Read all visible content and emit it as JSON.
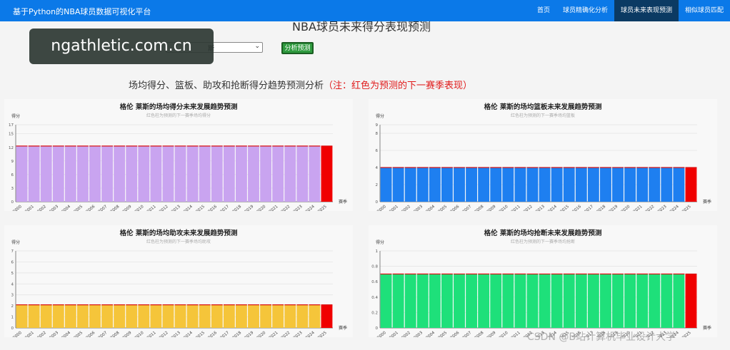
{
  "navbar": {
    "brand": "基于Python的NBA球员数据可视化平台",
    "links": [
      {
        "label": "首页",
        "active": false
      },
      {
        "label": "球员精确化分析",
        "active": false
      },
      {
        "label": "球员未来表现预测",
        "active": true
      },
      {
        "label": "相似球员匹配",
        "active": false
      }
    ]
  },
  "page_title": "NBA球员未来得分表现预测",
  "player_select": {
    "value": "斯"
  },
  "predict_button": "分析预测",
  "section_title": "场均得分、篮板、助攻和抢断得分趋势预测分析",
  "section_note": "（注：红色为预测的下一赛季表现）",
  "watermark": "ngathletic.com.cn",
  "csdn_watermark": "CSDN @B站计算机毕业设计大学",
  "colors": {
    "predict": "#f00000"
  },
  "chart_data": [
    {
      "type": "bar",
      "title": "格伦 莱斯的场均得分未来发展趋势预测",
      "subtitle": "红色柱为预测的下一赛季场均得分",
      "ylabel": "得分",
      "xlabel": "赛季",
      "color": "#c9a4f0",
      "ylim": [
        0,
        17
      ],
      "yticks": [
        0,
        3,
        6,
        9,
        12,
        15,
        17
      ],
      "categories": [
        "2000",
        "2001",
        "2002",
        "2003",
        "2004",
        "2005",
        "2006",
        "2007",
        "2008",
        "2009",
        "2010",
        "2011",
        "2012",
        "2013",
        "2014",
        "2015",
        "2016",
        "2017",
        "2018",
        "2019",
        "2020",
        "2021",
        "2022",
        "2023",
        "2024",
        "2025"
      ],
      "values": [
        12.3,
        12.3,
        12.3,
        12.3,
        12.3,
        12.3,
        12.3,
        12.3,
        12.3,
        12.3,
        12.3,
        12.3,
        12.3,
        12.3,
        12.3,
        12.3,
        12.3,
        12.3,
        12.3,
        12.3,
        12.3,
        12.3,
        12.3,
        12.3,
        12.3,
        12.3
      ],
      "predicted_index": 25
    },
    {
      "type": "bar",
      "title": "格伦 莱斯的场均篮板未来发展趋势预测",
      "subtitle": "红色柱为预测的下一赛季场均篮板",
      "ylabel": "得分",
      "xlabel": "赛季",
      "color": "#1e7ff0",
      "ylim": [
        0,
        9
      ],
      "yticks": [
        0,
        2,
        4,
        6,
        8,
        9
      ],
      "categories": [
        "2000",
        "2001",
        "2002",
        "2003",
        "2004",
        "2005",
        "2006",
        "2007",
        "2008",
        "2009",
        "2010",
        "2011",
        "2012",
        "2013",
        "2014",
        "2015",
        "2016",
        "2017",
        "2018",
        "2019",
        "2020",
        "2021",
        "2022",
        "2023",
        "2024",
        "2025"
      ],
      "values": [
        4,
        4,
        4,
        4,
        4,
        4,
        4,
        4,
        4,
        4,
        4,
        4,
        4,
        4,
        4,
        4,
        4,
        4,
        4,
        4,
        4,
        4,
        4,
        4,
        4,
        4
      ],
      "predicted_index": 25
    },
    {
      "type": "bar",
      "title": "格伦 莱斯的场均助攻未来发展趋势预测",
      "subtitle": "红色柱为预测的下一赛季场均助攻",
      "ylabel": "得分",
      "xlabel": "赛季",
      "color": "#f5c53a",
      "ylim": [
        0,
        7
      ],
      "yticks": [
        0,
        1,
        2,
        3,
        4,
        5,
        6,
        7
      ],
      "categories": [
        "2000",
        "2001",
        "2002",
        "2003",
        "2004",
        "2005",
        "2006",
        "2007",
        "2008",
        "2009",
        "2010",
        "2011",
        "2012",
        "2013",
        "2014",
        "2015",
        "2016",
        "2017",
        "2018",
        "2019",
        "2020",
        "2021",
        "2022",
        "2023",
        "2024",
        "2025"
      ],
      "values": [
        2.1,
        2.1,
        2.1,
        2.1,
        2.1,
        2.1,
        2.1,
        2.1,
        2.1,
        2.1,
        2.1,
        2.1,
        2.1,
        2.1,
        2.1,
        2.1,
        2.1,
        2.1,
        2.1,
        2.1,
        2.1,
        2.1,
        2.1,
        2.1,
        2.1,
        2.1
      ],
      "predicted_index": 25
    },
    {
      "type": "bar",
      "title": "格伦 莱斯的场均抢断未来发展趋势预测",
      "subtitle": "红色柱为预测的下一赛季场均抢断",
      "ylabel": "得分",
      "xlabel": "赛季",
      "color": "#1ee07a",
      "ylim": [
        0,
        1
      ],
      "yticks": [
        0,
        0.2,
        0.4,
        0.6,
        0.8,
        1
      ],
      "categories": [
        "2000",
        "2001",
        "2002",
        "2003",
        "2004",
        "2005",
        "2006",
        "2007",
        "2008",
        "2009",
        "2010",
        "2011",
        "2012",
        "2013",
        "2014",
        "2015",
        "2016",
        "2017",
        "2018",
        "2019",
        "2020",
        "2021",
        "2022",
        "2023",
        "2024",
        "2025"
      ],
      "values": [
        0.7,
        0.7,
        0.7,
        0.7,
        0.7,
        0.7,
        0.7,
        0.7,
        0.7,
        0.7,
        0.7,
        0.7,
        0.7,
        0.7,
        0.7,
        0.7,
        0.7,
        0.7,
        0.7,
        0.7,
        0.7,
        0.7,
        0.7,
        0.7,
        0.7,
        0.7
      ],
      "predicted_index": 25
    }
  ]
}
